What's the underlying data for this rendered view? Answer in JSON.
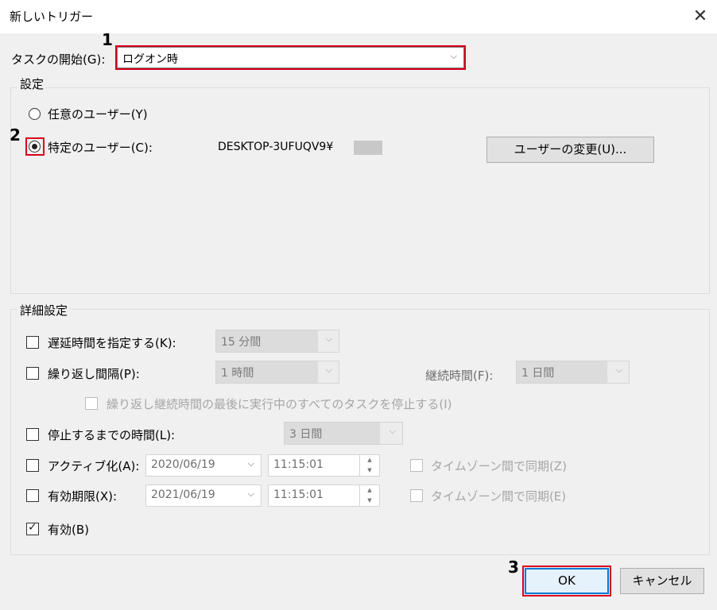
{
  "window": {
    "title": "新しいトリガー"
  },
  "begin_task": {
    "label": "タスクの開始(G):",
    "value": "ログオン時"
  },
  "settings": {
    "group_title": "設定",
    "any_user_label": "任意のユーザー(Y)",
    "specific_user_label": "特定のユーザー(C):",
    "user_value": "DESKTOP-3UFUQV9¥",
    "change_user_button": "ユーザーの変更(U)..."
  },
  "advanced": {
    "group_title": "詳細設定",
    "delay_label": "遅延時間を指定する(K):",
    "delay_value": "15 分間",
    "repeat_label": "繰り返し間隔(P):",
    "repeat_value": "1 時間",
    "duration_label": "継続時間(F):",
    "duration_value": "1 日間",
    "stop_all_label": "繰り返し継続時間の最後に実行中のすべてのタスクを停止する(I)",
    "stop_after_label": "停止するまでの時間(L):",
    "stop_after_value": "3 日間",
    "activate_label": "アクティブ化(A):",
    "activate_date": "2020/06/19",
    "activate_time": "11:15:01",
    "activate_sync_label": "タイムゾーン間で同期(Z)",
    "expire_label": "有効期限(X):",
    "expire_date": "2021/06/19",
    "expire_time": "11:15:01",
    "expire_sync_label": "タイムゾーン間で同期(E)",
    "enabled_label": "有効(B)"
  },
  "buttons": {
    "ok": "OK",
    "cancel": "キャンセル"
  },
  "annotations": {
    "one": "1",
    "two": "2",
    "three": "3"
  },
  "colors": {
    "highlight": "#d9001b",
    "default_button_border": "#0078d7"
  }
}
